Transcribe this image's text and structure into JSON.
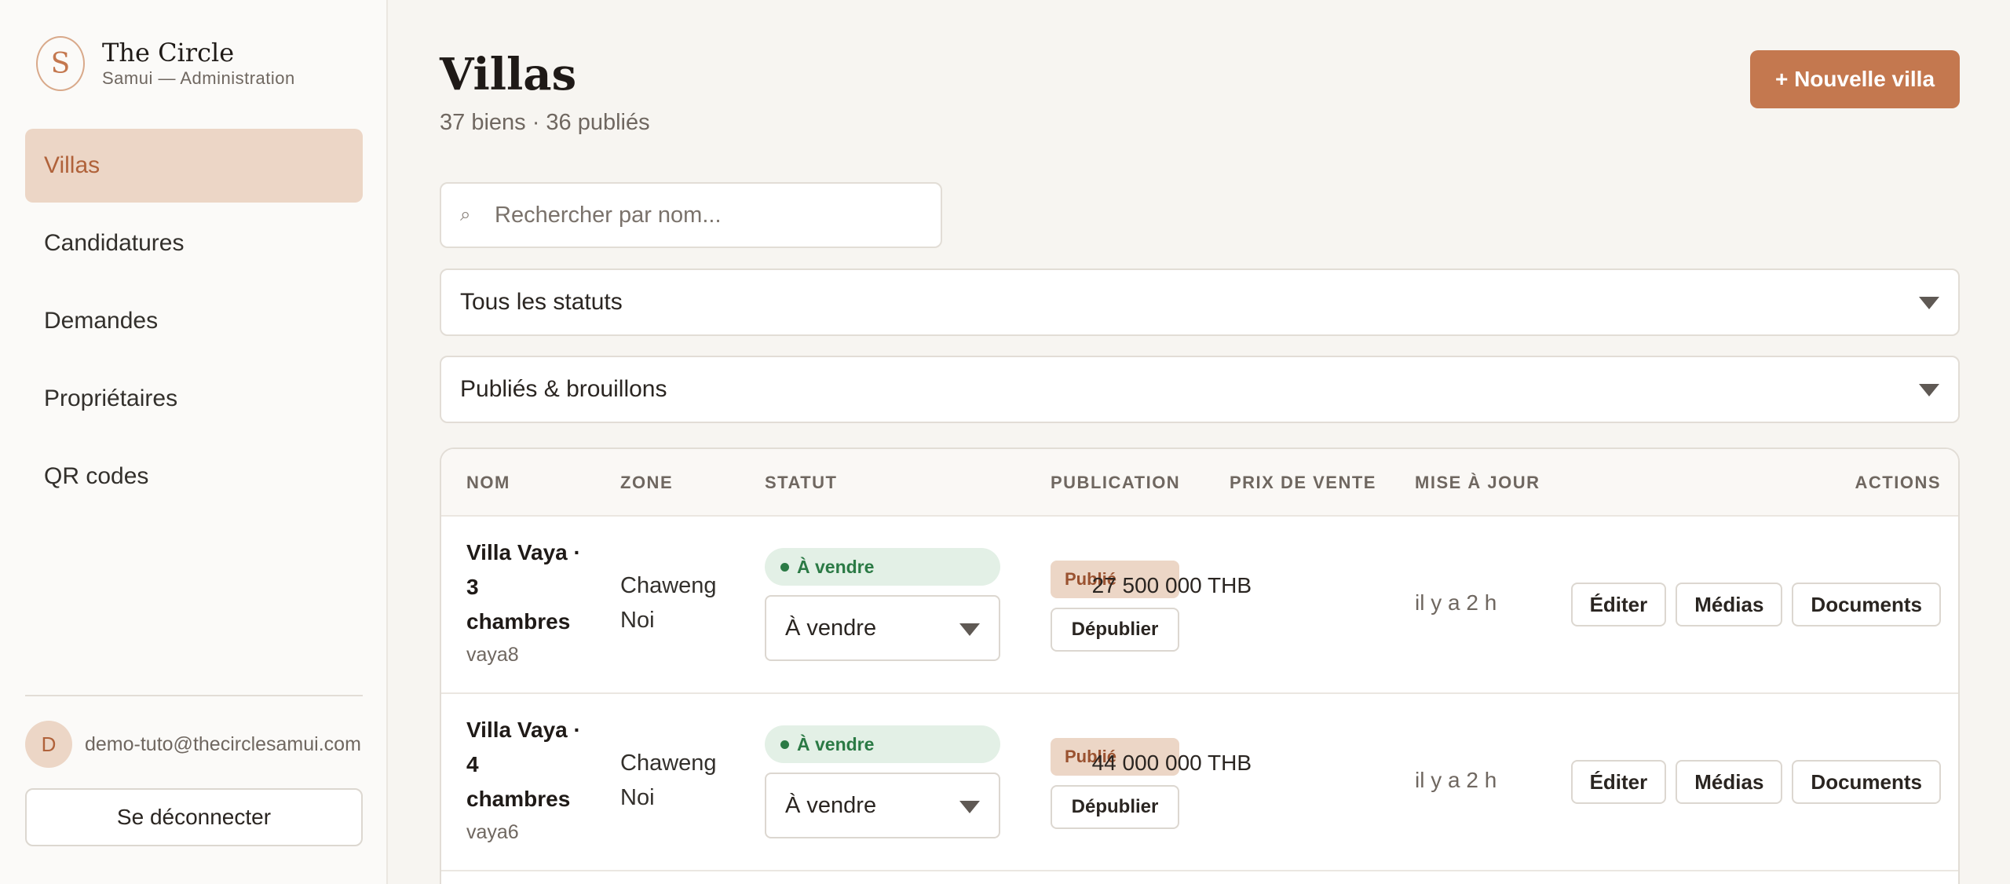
{
  "brand": {
    "title": "The Circle",
    "subtitle": "Samui — Administration",
    "logo_glyph": "S"
  },
  "nav": [
    {
      "label": "Villas",
      "active": true
    },
    {
      "label": "Candidatures"
    },
    {
      "label": "Demandes"
    },
    {
      "label": "Propriétaires"
    },
    {
      "label": "QR codes"
    }
  ],
  "user": {
    "initial": "D",
    "email": "demo-tuto@thecirclesamui.com"
  },
  "logout_label": "Se déconnecter",
  "header": {
    "title": "Villas",
    "subtitle": "37 biens · 36 publiés",
    "new_button": "+ Nouvelle villa"
  },
  "search": {
    "icon": "search-icon",
    "glyph": "⌕",
    "placeholder": "Rechercher par nom..."
  },
  "filters": {
    "status": "Tous les statuts",
    "publication": "Publiés & brouillons"
  },
  "table": {
    "columns": [
      "NOM",
      "ZONE",
      "STATUT",
      "PUBLICATION",
      "PRIX DE VENTE",
      "MISE À JOUR",
      "ACTIONS"
    ],
    "rows": [
      {
        "name": "Villa Vaya · 3 chambres",
        "slug": "vaya8",
        "zone": "Chaweng Noi",
        "status_badge": "À vendre",
        "status_value": "À vendre",
        "publication_badge": "Publié",
        "unpublish_label": "Dépublier",
        "price": "27 500 000 THB",
        "updated": "il y a 2 h",
        "actions": {
          "edit": "Éditer",
          "media": "Médias",
          "documents": "Documents"
        }
      },
      {
        "name": "Villa Vaya · 4 chambres",
        "slug": "vaya6",
        "zone": "Chaweng Noi",
        "status_badge": "À vendre",
        "status_value": "À vendre",
        "publication_badge": "Publié",
        "unpublish_label": "Dépublier",
        "price": "44 000 000 THB",
        "updated": "il y a 2 h",
        "actions": {
          "edit": "Éditer",
          "media": "Médias",
          "documents": "Documents"
        }
      }
    ]
  },
  "colors": {
    "accent": "#c4784f",
    "accent_soft": "#ecd6c6",
    "status_green": "#2b7a45",
    "status_green_bg": "#e3f0e6",
    "background": "#f7f5f1"
  }
}
